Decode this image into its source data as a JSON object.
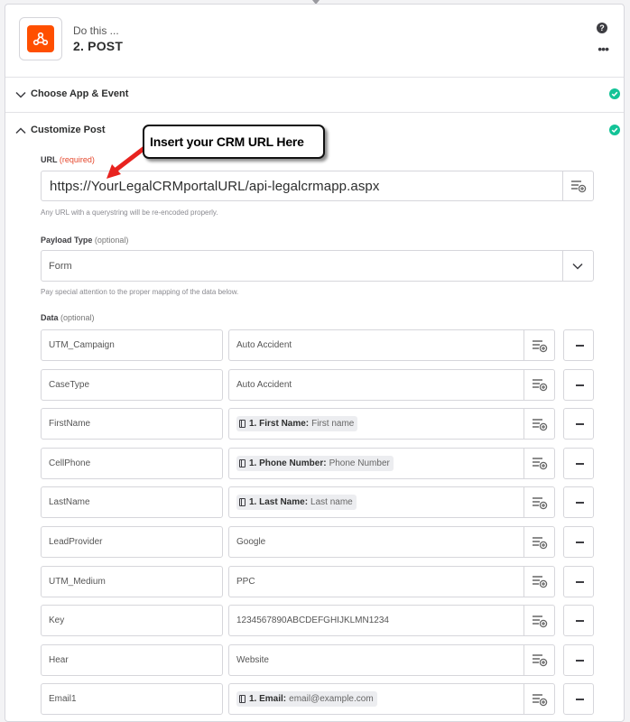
{
  "header": {
    "subtitle": "Do this ...",
    "title": "2. POST",
    "help_icon": "question-circle-icon",
    "more_icon": "ellipsis-icon",
    "app_icon": "webhook-icon",
    "app_color": "#ff4f00"
  },
  "sections": {
    "choose_app": {
      "label": "Choose App & Event",
      "status": "complete"
    },
    "customize": {
      "label": "Customize Post",
      "status": "complete"
    }
  },
  "url_field": {
    "label": "URL",
    "required_tag": "(required)",
    "value": "https://YourLegalCRMportalURL/api-legalcrmapp.aspx",
    "hint": "Any URL with a querystring will be re-encoded properly."
  },
  "payload_type": {
    "label": "Payload Type",
    "optional_tag": "(optional)",
    "value": "Form",
    "hint": "Pay special attention to the proper mapping of the data below."
  },
  "data_section": {
    "label": "Data",
    "optional_tag": "(optional)",
    "rows": [
      {
        "key": "UTM_Campaign",
        "value": "Auto Accident"
      },
      {
        "key": "CaseType",
        "value": "Auto Accident"
      },
      {
        "key": "FirstName",
        "pill_label": "1. First Name:",
        "pill_value": "First name"
      },
      {
        "key": "CellPhone",
        "pill_label": "1. Phone Number:",
        "pill_value": "Phone Number"
      },
      {
        "key": "LastName",
        "pill_label": "1. Last Name:",
        "pill_value": "Last name"
      },
      {
        "key": "LeadProvider",
        "value": "Google"
      },
      {
        "key": "UTM_Medium",
        "value": "PPC"
      },
      {
        "key": "Key",
        "value": "1234567890ABCDEFGHIJKLMN1234"
      },
      {
        "key": "Hear",
        "value": "Website"
      },
      {
        "key": "Email1",
        "pill_label": "1. Email:",
        "pill_value": "email@example.com"
      }
    ]
  },
  "annotation": {
    "text": "Insert your CRM URL Here",
    "arrow_color": "#e8231f"
  },
  "colors": {
    "check": "#13c397",
    "required": "#e5472c"
  }
}
